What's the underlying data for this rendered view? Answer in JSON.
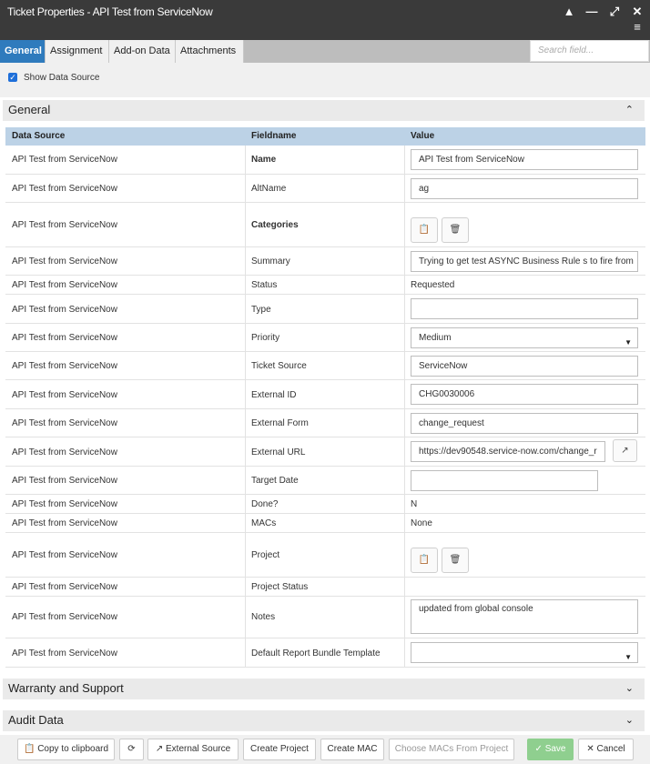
{
  "window": {
    "title": "Ticket Properties - API Test from ServiceNow",
    "controls": {
      "collapse": "▲",
      "minimize": "—",
      "maximize": "⤢",
      "close": "✕",
      "menu": "≡"
    }
  },
  "tabs": [
    {
      "label": "General",
      "active": true
    },
    {
      "label": "Assignment",
      "active": false
    },
    {
      "label": "Add-on Data",
      "active": false
    },
    {
      "label": "Attachments",
      "active": false
    }
  ],
  "search": {
    "placeholder": "Search field..."
  },
  "options": {
    "show_data_source": "Show Data Source",
    "show_data_source_checked": true
  },
  "sections": {
    "general": "General",
    "warranty": "Warranty and Support",
    "audit": "Audit Data"
  },
  "grid": {
    "columns": [
      "Data Source",
      "Fieldname",
      "Value"
    ],
    "rows": [
      {
        "source": "API Test from ServiceNow",
        "field": "Name",
        "bold": true,
        "type": "input",
        "value": "API Test from ServiceNow"
      },
      {
        "source": "API Test from ServiceNow",
        "field": "AltName",
        "type": "input",
        "value": "ag"
      },
      {
        "source": "API Test from ServiceNow",
        "field": "Categories",
        "bold": true,
        "type": "buttons",
        "value": ""
      },
      {
        "source": "API Test from ServiceNow",
        "field": "Summary",
        "type": "input",
        "value": "Trying to get test ASYNC Business Rule s to fire from"
      },
      {
        "source": "API Test from ServiceNow",
        "field": "Status",
        "type": "text",
        "value": "Requested"
      },
      {
        "source": "API Test from ServiceNow",
        "field": "Type",
        "type": "input",
        "value": ""
      },
      {
        "source": "API Test from ServiceNow",
        "field": "Priority",
        "type": "select",
        "value": "Medium"
      },
      {
        "source": "API Test from ServiceNow",
        "field": "Ticket Source",
        "type": "input",
        "value": "ServiceNow"
      },
      {
        "source": "API Test from ServiceNow",
        "field": "External ID",
        "type": "input",
        "value": "CHG0030006"
      },
      {
        "source": "API Test from ServiceNow",
        "field": "External Form",
        "type": "input",
        "value": "change_request"
      },
      {
        "source": "API Test from ServiceNow",
        "field": "External URL",
        "type": "url",
        "value": "https://dev90548.service-now.com/change_r"
      },
      {
        "source": "API Test from ServiceNow",
        "field": "Target Date",
        "type": "input",
        "value": ""
      },
      {
        "source": "API Test from ServiceNow",
        "field": "Done?",
        "type": "text",
        "value": "N"
      },
      {
        "source": "API Test from ServiceNow",
        "field": "MACs",
        "type": "text",
        "value": "None"
      },
      {
        "source": "API Test from ServiceNow",
        "field": "Project",
        "type": "buttons",
        "value": ""
      },
      {
        "source": "API Test from ServiceNow",
        "field": "Project Status",
        "type": "text",
        "value": ""
      },
      {
        "source": "API Test from ServiceNow",
        "field": "Notes",
        "type": "textarea",
        "value": "updated from global console"
      },
      {
        "source": "API Test from ServiceNow",
        "field": "Default Report Bundle Template",
        "type": "select",
        "value": ""
      }
    ]
  },
  "footer": {
    "copy": "Copy to clipboard",
    "refresh_icon": "refresh-icon",
    "external_source": "External Source",
    "create_project": "Create Project",
    "create_mac": "Create MAC",
    "choose_macs": "Choose MACs From Project",
    "save": "Save",
    "cancel": "Cancel"
  },
  "colors": {
    "titlebar": "#3a3a3a",
    "active_tab": "#2f7bbd",
    "grid_header": "#bcd2e6",
    "save_button": "#8fcf8f"
  }
}
